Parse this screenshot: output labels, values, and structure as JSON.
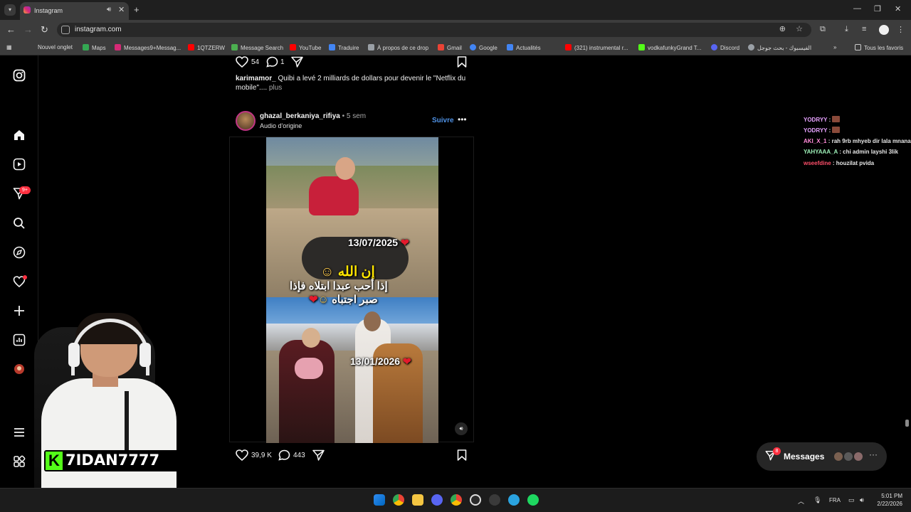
{
  "browser": {
    "tab_title": "Instagram",
    "tab_close": "✕",
    "new_tab": "+",
    "url": "instagram.com",
    "window_controls": [
      "—",
      "❐",
      "✕"
    ],
    "bookmarks": [
      {
        "label": "Nouvel onglet",
        "color": "#5f6368"
      },
      {
        "label": "Maps",
        "color": "#34a853"
      },
      {
        "label": "Messages9+Messag...",
        "color": "#d62976"
      },
      {
        "label": "1QTZERW",
        "color": "#ff0000"
      },
      {
        "label": "Message Search",
        "color": "#4caf50"
      },
      {
        "label": "YouTube",
        "color": "#ff0000"
      },
      {
        "label": "Traduire",
        "color": "#4285f4"
      },
      {
        "label": "À propos de ce drop",
        "color": "#9aa0a6"
      },
      {
        "label": "Gmail",
        "color": "#ea4335"
      },
      {
        "label": "Google",
        "color": "#4285f4"
      },
      {
        "label": "Actualités",
        "color": "#4285f4"
      },
      {
        "label": "(321) instrumental r...",
        "color": "#ff0000"
      },
      {
        "label": "vodkafunkyGrand T...",
        "color": "#53fc18"
      },
      {
        "label": "Discord",
        "color": "#5865f2"
      },
      {
        "label": "الفيسبوك - بحث جوجل",
        "color": "#9aa0a6"
      }
    ],
    "all_bookmarks": "Tous les favoris"
  },
  "sidebar": {
    "notifications_badge": "9+"
  },
  "previous_post": {
    "likes": "54",
    "comments": "1",
    "caption_user": "karimamor_",
    "caption_text": "Quibi a levé 2 milliards de dollars pour devenir le \"Netflix du mobile\"....",
    "more": "plus"
  },
  "post": {
    "username": "ghazal_berkaniya_rifiya",
    "time": "• 5 sem",
    "audio": "Audio d'origine",
    "follow": "Suivre",
    "overlay_date1": "13/07/2025",
    "overlay_line1": "إن الله",
    "overlay_line2": "إذا أحب عبدا ابتلاه فإذا",
    "overlay_line3": "صبر اجتباه",
    "overlay_date2": "13/01/2026",
    "likes": "39,9 K",
    "comments": "443"
  },
  "chat": [
    {
      "user": "YODRYY",
      "text": "",
      "color": "#e7a2ff"
    },
    {
      "user": "YODRYY",
      "text": "",
      "color": "#e7a2ff"
    },
    {
      "user": "AKI_X_1",
      "text": "rah 9rb mhyeb dir lala mnana",
      "color": "#ff8ad8"
    },
    {
      "user": "YAHYAAA_A",
      "text": "chi admin layshi 3lik",
      "color": "#9df0b8"
    },
    {
      "user": "wseefdine",
      "text": "houzilat pvida",
      "color": "#ff4f6a"
    }
  ],
  "messages": {
    "label": "Messages",
    "badge": "8"
  },
  "stream": {
    "channel": "7IDAN7777",
    "kick_logo": "K"
  },
  "taskbar": {
    "lang": "FRA",
    "time": "5:01 PM",
    "date": "2/22/2026"
  }
}
